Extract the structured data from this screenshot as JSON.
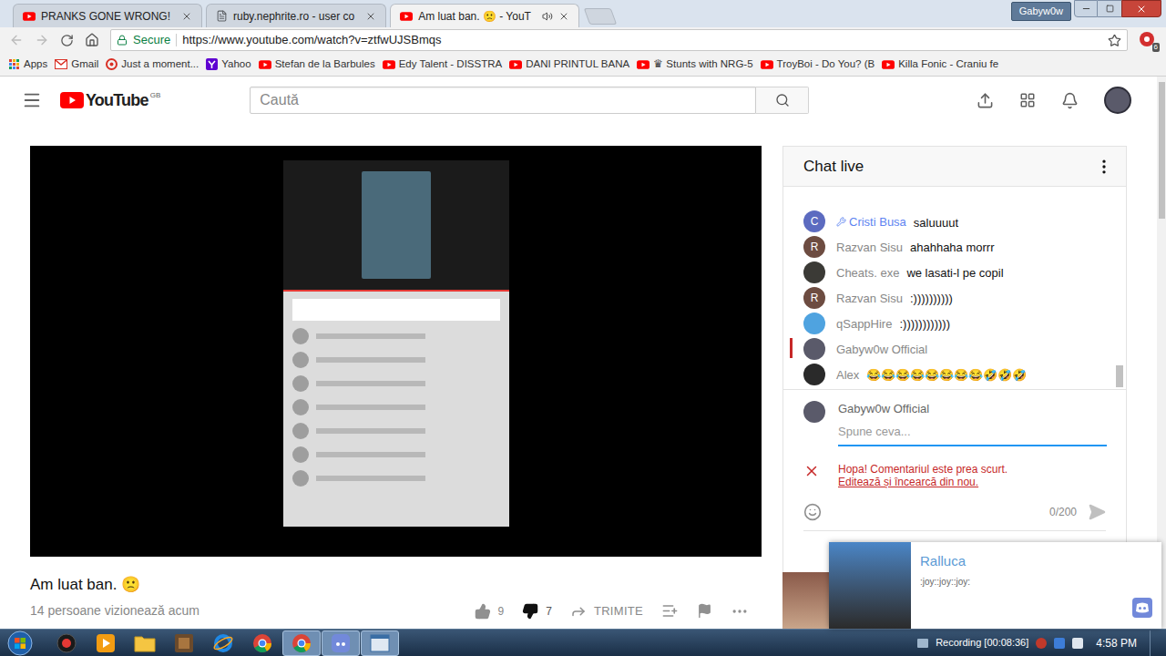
{
  "browser": {
    "tabs": [
      {
        "title": "PRANKS GONE WRONG!",
        "kind": "youtube",
        "selected": false,
        "audio": false
      },
      {
        "title": "ruby.nephrite.ro - user co",
        "kind": "page",
        "selected": false,
        "audio": false
      },
      {
        "title": "Am luat ban. 🙁 - YouT",
        "kind": "youtube",
        "selected": true,
        "audio": true
      }
    ],
    "profile": "Gabyw0w",
    "secure_label": "Secure",
    "url": "https://www.youtube.com/watch?v=ztfwUJSBmqs",
    "extension_badge": "6",
    "bookmarks": [
      {
        "label": "Apps",
        "kind": "apps"
      },
      {
        "label": "Gmail",
        "kind": "gmail"
      },
      {
        "label": "Just a moment...",
        "kind": "site"
      },
      {
        "label": "Yahoo",
        "kind": "yahoo"
      },
      {
        "label": "Stefan de la Barbules",
        "kind": "youtube"
      },
      {
        "label": "Edy Talent - DISSTRA",
        "kind": "youtube"
      },
      {
        "label": "DANI PRINTUL BANA",
        "kind": "youtube"
      },
      {
        "label": "♛ Stunts with NRG-5",
        "kind": "youtube"
      },
      {
        "label": "TroyBoi - Do You? (B",
        "kind": "youtube"
      },
      {
        "label": "Killa Fonic - Craniu fe",
        "kind": "youtube"
      }
    ]
  },
  "youtube": {
    "logo": "YouTube",
    "region": "GB",
    "search_placeholder": "Caută"
  },
  "video": {
    "title": "Am luat ban. 🙁",
    "viewers": "14 persoane vizionează acum",
    "likes": "9",
    "dislikes": "7",
    "liked": false,
    "disliked": true,
    "share": "TRIMITE"
  },
  "chat": {
    "title": "Chat live",
    "messages": [
      {
        "author": "Cristi Busa",
        "text": "saluuuut",
        "moderator": true,
        "highlighted": false,
        "avatar": {
          "kind": "letter",
          "letter": "C",
          "color": "#5c6bc0"
        }
      },
      {
        "author": "Razvan Sisu",
        "text": "ahahhaha morrr",
        "moderator": false,
        "highlighted": false,
        "avatar": {
          "kind": "letter",
          "letter": "R",
          "color": "#6d4c41"
        }
      },
      {
        "author": "Cheats. exe",
        "text": "we lasati-l pe copil",
        "moderator": false,
        "highlighted": false,
        "avatar": {
          "kind": "photo",
          "color": "#3b3a36"
        }
      },
      {
        "author": "Razvan Sisu",
        "text": ":))))))))))",
        "moderator": false,
        "highlighted": false,
        "avatar": {
          "kind": "letter",
          "letter": "R",
          "color": "#6d4c41"
        }
      },
      {
        "author": "qSappHire",
        "text": ":))))))))))))",
        "moderator": false,
        "highlighted": false,
        "avatar": {
          "kind": "photo",
          "color": "#4fa3e0"
        }
      },
      {
        "author": "Gabyw0w Official",
        "moderator": false,
        "highlighted": true,
        "avatar": {
          "kind": "photo",
          "color": "#5a5a6a"
        }
      },
      {
        "author": "Alex",
        "text": "😂😂😂😂😂😂😂😂🤣🤣🤣",
        "moderator": false,
        "highlighted": false,
        "avatar": {
          "kind": "photo",
          "color": "#2a2a2a"
        }
      }
    ],
    "input": {
      "author": "Gabyw0w Official",
      "placeholder": "Spune ceva...",
      "error": "Hopa! Comentariul este prea scurt.",
      "error_action": "Editează și încearcă din nou.",
      "counter": "0/200"
    }
  },
  "notification": {
    "name": "Ralluca",
    "message": ":joy::joy::joy:"
  },
  "taskbar": {
    "apps": [
      {
        "kind": "recorder",
        "active": false
      },
      {
        "kind": "media",
        "active": false
      },
      {
        "kind": "explorer",
        "active": false
      },
      {
        "kind": "game",
        "active": false
      },
      {
        "kind": "ie",
        "active": false
      },
      {
        "kind": "chrome",
        "active": false
      },
      {
        "kind": "chrome",
        "active": true
      },
      {
        "kind": "discord",
        "active": true
      },
      {
        "kind": "window",
        "active": true
      }
    ],
    "tray_text": "Recording [00:08:36]",
    "time": "4:58 PM"
  }
}
